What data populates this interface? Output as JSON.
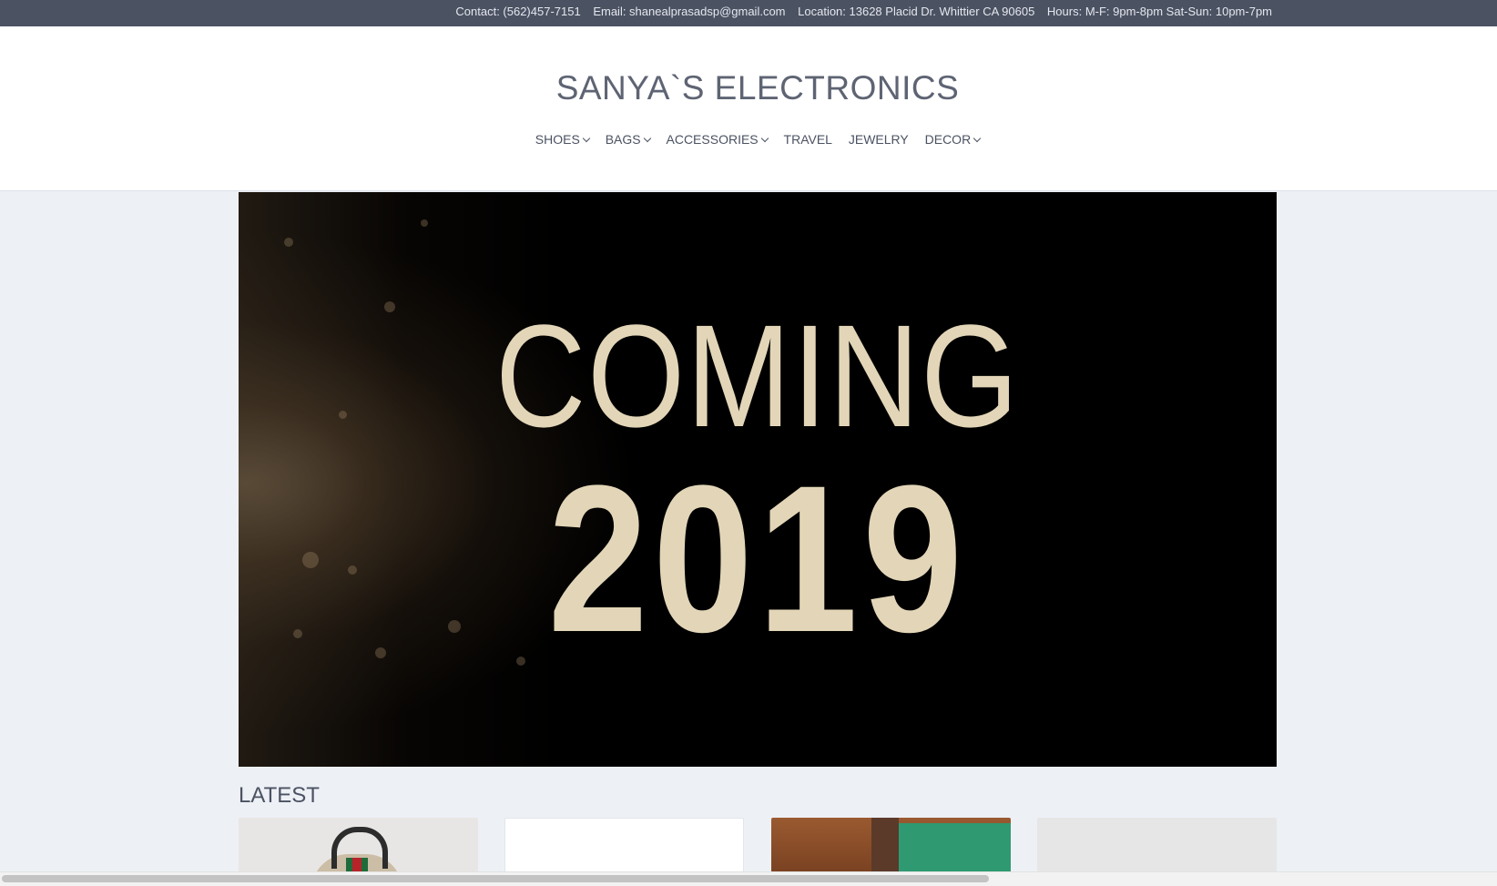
{
  "topbar": {
    "contact": "Contact: (562)457-7151",
    "email": "Email: shanealprasadsp@gmail.com",
    "location": "Location: 13628 Placid Dr. Whittier CA 90605",
    "hours": "Hours: M-F: 9pm-8pm Sat-Sun: 10pm-7pm"
  },
  "header": {
    "site_title": "SANYA`S ELECTRONICS"
  },
  "nav": {
    "items": [
      {
        "label": "SHOES"
      },
      {
        "label": "BAGS"
      },
      {
        "label": "ACCESSORIES"
      },
      {
        "label": "TRAVEL"
      },
      {
        "label": "JEWELRY"
      },
      {
        "label": "DECOR"
      }
    ]
  },
  "hero": {
    "line1": "COMING",
    "line2": "2019"
  },
  "latest": {
    "title": "LATEST"
  },
  "colors": {
    "topbar_bg": "#4b5262",
    "page_bg": "#edf0f5",
    "hero_text": "#e3d6b8"
  },
  "icons": {
    "nav_dropdown": "chevron-down-icon"
  }
}
